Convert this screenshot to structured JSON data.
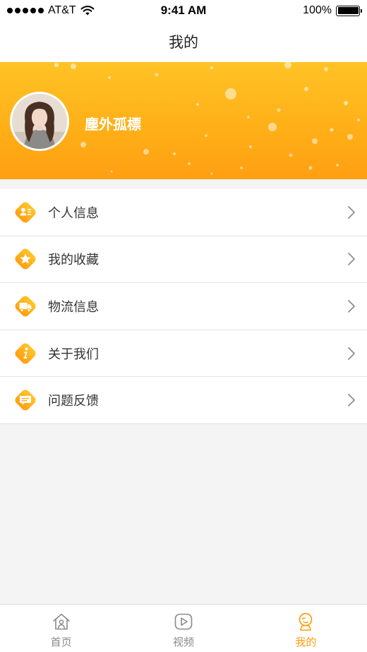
{
  "status_bar": {
    "carrier": "AT&T",
    "time": "9:41 AM",
    "battery_text": "100%",
    "battery_level": 1.0
  },
  "nav": {
    "title": "我的"
  },
  "profile": {
    "username": "塵外孤標",
    "avatar_icon": "user-avatar-photo"
  },
  "menu": {
    "items": [
      {
        "label": "个人信息",
        "icon": "person-card-icon"
      },
      {
        "label": "我的收藏",
        "icon": "star-icon"
      },
      {
        "label": "物流信息",
        "icon": "truck-icon"
      },
      {
        "label": "关于我们",
        "icon": "info-icon"
      },
      {
        "label": "问题反馈",
        "icon": "chat-bubble-icon"
      }
    ]
  },
  "tabs": {
    "items": [
      {
        "label": "首页",
        "icon": "home-icon",
        "active": false
      },
      {
        "label": "视频",
        "icon": "play-icon",
        "active": false
      },
      {
        "label": "我的",
        "icon": "profile-icon",
        "active": true
      }
    ]
  },
  "colors": {
    "accent": "#ff9d0f",
    "banner_top": "#ffc325",
    "banner_bottom": "#ff9f12",
    "inactive_tab": "#8a8a8a",
    "background": "#f4f4f4"
  }
}
